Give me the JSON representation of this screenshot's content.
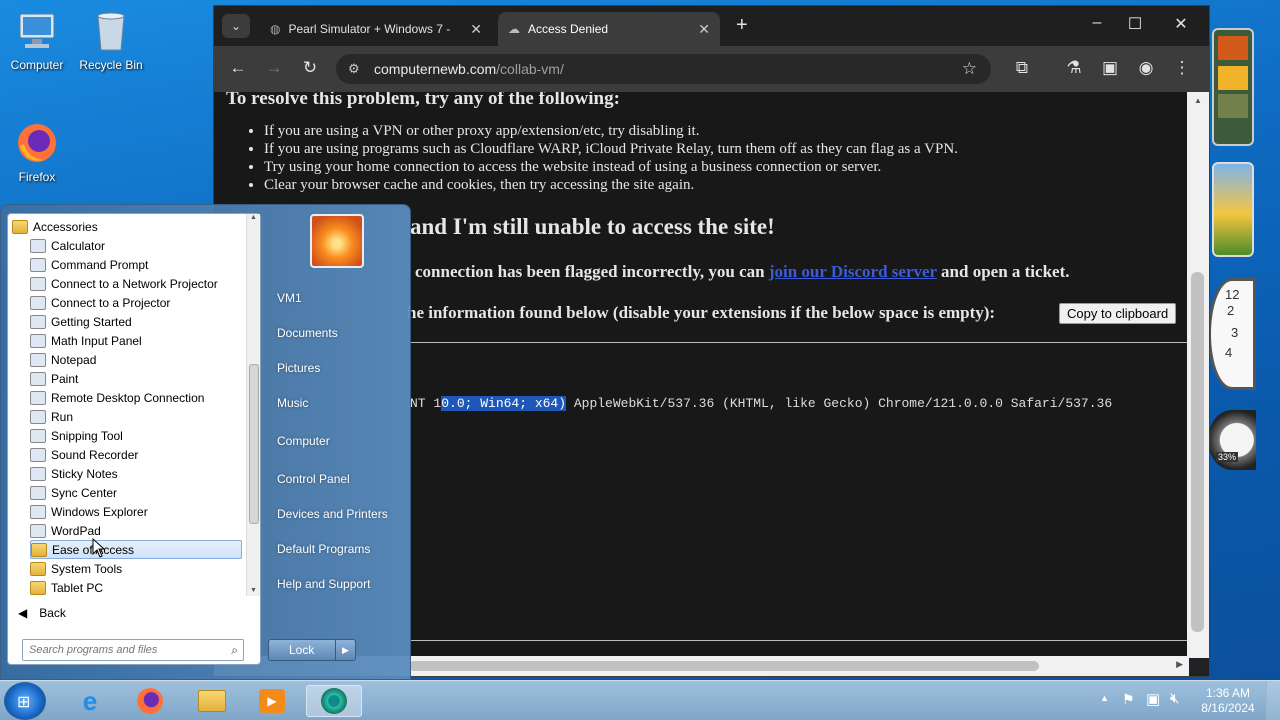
{
  "desktop": {
    "icons": [
      {
        "label": "Computer"
      },
      {
        "label": "Recycle Bin"
      },
      {
        "label": "Firefox"
      }
    ]
  },
  "browser": {
    "tabs": [
      {
        "title": "Pearl Simulator + Windows 7 -",
        "active": false
      },
      {
        "title": "Access Denied",
        "active": true
      }
    ],
    "url_domain": "computernewb.com",
    "url_path": "/collab-vm/",
    "page": {
      "heading_partial": "To resolve this problem, try any of the following:",
      "bullets": [
        "If you are using a VPN or other proxy app/extension/etc, try disabling it.",
        "If you are using programs such as Cloudflare WARP, iCloud Private Relay, turn them off as they can flag as a VPN.",
        "Try using your home connection to access the website instead of using a business connection or server.",
        "Clear your browser cache and cookies, then try accessing the site again."
      ],
      "heading2": "and I'm still unable to access the site!",
      "para1_a": "connection has been flagged incorrectly, you can",
      "para1_link": "join our Discord server",
      "para1_b": "and open a ticket.",
      "para2": "he information found below (disable your extensions if the below space is empty):",
      "copy_button": "Copy to clipboard",
      "ua_pre": "NT 1",
      "ua_highlight": "0.0; Win64; x64)",
      "ua_post": " AppleWebKit/537.36 (KHTML, like Gecko) Chrome/121.0.0.0 Safari/537.36"
    }
  },
  "start_menu": {
    "folder": "Accessories",
    "items": [
      "Calculator",
      "Command Prompt",
      "Connect to a Network Projector",
      "Connect to a Projector",
      "Getting Started",
      "Math Input Panel",
      "Notepad",
      "Paint",
      "Remote Desktop Connection",
      "Run",
      "Snipping Tool",
      "Sound Recorder",
      "Sticky Notes",
      "Sync Center",
      "Windows Explorer",
      "WordPad",
      "Ease of Access",
      "System Tools",
      "Tablet PC"
    ],
    "back": "Back",
    "search_placeholder": "Search programs and files",
    "right": [
      "VM1",
      "Documents",
      "Pictures",
      "Music",
      "Computer",
      "Control Panel",
      "Devices and Printers",
      "Default Programs",
      "Help and Support"
    ],
    "lock": "Lock"
  },
  "taskbar": {
    "time": "1:36 AM",
    "date": "8/16/2024"
  },
  "gadgets": {
    "cpu_percent": "33%",
    "clock_numbers": [
      "12",
      "2",
      "3",
      "4"
    ]
  }
}
